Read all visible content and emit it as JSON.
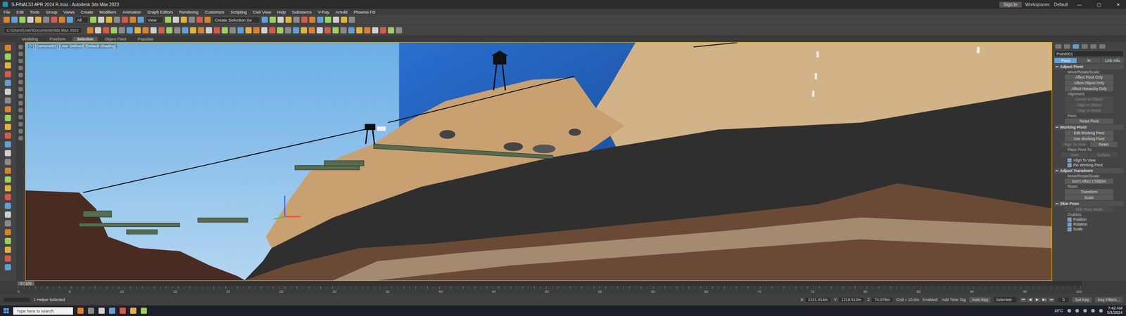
{
  "window": {
    "title": "S-FINAL33 APR 2024 R.max - Autodesk 3ds Max 2023",
    "sign_in": "Sign In",
    "workspaces": "Workspaces:",
    "workspace": "Default",
    "controls": [
      "—",
      "▢",
      "✕"
    ]
  },
  "menu": [
    "File",
    "Edit",
    "Tools",
    "Group",
    "Views",
    "Create",
    "Modifiers",
    "Animation",
    "Graph Editors",
    "Rendering",
    "Customize",
    "Scripting",
    "Civil View",
    "Help",
    "Substance",
    "V-Ray",
    "Arnold",
    "Phoenix FD"
  ],
  "toolbar": {
    "filter": "All",
    "view": "View",
    "selection_set": "Create Selection Se",
    "path": "C:\\Users\\User\\Documents\\3ds Max 2023"
  },
  "ribbon_tabs": [
    {
      "label": "Modeling",
      "selected": false
    },
    {
      "label": "Freeform",
      "selected": false
    },
    {
      "label": "Selection",
      "selected": true
    },
    {
      "label": "Object Paint",
      "selected": false
    },
    {
      "label": "Populate",
      "selected": false
    }
  ],
  "viewport": {
    "label": "[+] [Camera001] [User Defined] [Default Shading]"
  },
  "command_panel": {
    "tabs": [
      {
        "selected": false
      },
      {
        "selected": false
      },
      {
        "selected": true
      },
      {
        "selected": false
      },
      {
        "selected": false
      },
      {
        "selected": false
      }
    ],
    "object_name": "Point001",
    "subtabs": [
      {
        "label": "Pivot",
        "selected": true
      },
      {
        "label": "IK",
        "selected": false
      },
      {
        "label": "Link Info",
        "selected": false
      }
    ],
    "rollouts": [
      {
        "title": "Adjust Pivot",
        "items": [
          {
            "kind": "label",
            "text": "Move/Rotate/Scale:"
          },
          {
            "kind": "button",
            "text": "Affect Pivot Only",
            "selected": false,
            "disabled": false
          },
          {
            "kind": "button",
            "text": "Affect Object Only",
            "selected": false,
            "disabled": false
          },
          {
            "kind": "button",
            "text": "Affect Hierarchy Only",
            "selected": false,
            "disabled": false
          },
          {
            "kind": "label",
            "text": "Alignment:"
          },
          {
            "kind": "button",
            "text": "Center to Object",
            "selected": false,
            "disabled": true
          },
          {
            "kind": "button",
            "text": "Align to Object",
            "selected": false,
            "disabled": true
          },
          {
            "kind": "button",
            "text": "Align to World",
            "selected": false,
            "disabled": true
          },
          {
            "kind": "label",
            "text": "Pivot:"
          },
          {
            "kind": "button",
            "text": "Reset Pivot",
            "selected": false,
            "disabled": false
          }
        ]
      },
      {
        "title": "Working Pivot",
        "items": [
          {
            "kind": "button",
            "text": "Edit Working Pivot",
            "selected": false,
            "disabled": false
          },
          {
            "kind": "button",
            "text": "Use Working Pivot",
            "selected": false,
            "disabled": false
          },
          {
            "kind": "row",
            "buttons": [
              {
                "text": "Align To View",
                "selected": false,
                "disabled": true
              },
              {
                "text": "Reset",
                "selected": false,
                "disabled": false
              }
            ]
          },
          {
            "kind": "label",
            "text": "Place Pivot To:"
          },
          {
            "kind": "row",
            "buttons": [
              {
                "text": "View",
                "selected": false,
                "disabled": true
              },
              {
                "text": "Surface",
                "selected": false,
                "disabled": true
              }
            ]
          },
          {
            "kind": "checkbox",
            "text": "Align To View",
            "checked": true,
            "disabled": false
          },
          {
            "kind": "checkbox",
            "text": "Pin Working Pivot",
            "checked": true,
            "disabled": false
          }
        ]
      },
      {
        "title": "Adjust Transform",
        "items": [
          {
            "kind": "label",
            "text": "Move/Rotate/Scale:"
          },
          {
            "kind": "button",
            "text": "Don't Affect Children",
            "selected": false,
            "disabled": false
          },
          {
            "kind": "label",
            "text": "Reset:"
          },
          {
            "kind": "button",
            "text": "Transform",
            "selected": false,
            "disabled": false
          },
          {
            "kind": "button",
            "text": "Scale",
            "selected": false,
            "disabled": false
          }
        ]
      },
      {
        "title": "Skin Pose",
        "items": [
          {
            "kind": "button",
            "text": "Skin Pose Mode",
            "selected": false,
            "disabled": true
          },
          {
            "kind": "label",
            "text": "Enables:"
          },
          {
            "kind": "checkbox",
            "text": "Position",
            "checked": true,
            "disabled": false
          },
          {
            "kind": "checkbox",
            "text": "Rotation",
            "checked": true,
            "disabled": false
          },
          {
            "kind": "checkbox",
            "text": "Scale",
            "checked": true,
            "disabled": false
          }
        ]
      }
    ]
  },
  "timeline": {
    "slider": "0 / 100",
    "ticks": [
      "0",
      "5",
      "10",
      "15",
      "20",
      "25",
      "30",
      "35",
      "40",
      "45",
      "50",
      "55",
      "60",
      "65",
      "70",
      "75",
      "80",
      "85",
      "90",
      "95",
      "100"
    ]
  },
  "status": {
    "selection": "1 Helper Selected",
    "x_label": "X:",
    "x": "1221.014m",
    "y_label": "Y:",
    "y": "1218.512m",
    "z_label": "Z:",
    "z": "74.078m",
    "grid": "Grid = 10.0m",
    "add_time_tag": "Add Time Tag",
    "enabled": "Enabled:",
    "auto_key": "Auto Key",
    "key_mode": "Selected",
    "set_key": "Set Key",
    "key_filters": "Key Filters...",
    "frame": "0",
    "playback": [
      "⏮",
      "◀",
      "▶",
      "▶|",
      "⏭"
    ]
  },
  "taskbar": {
    "search": "Type here to search",
    "weather": "19°C",
    "time": "7:42 AM",
    "date": "5/1/2024"
  }
}
